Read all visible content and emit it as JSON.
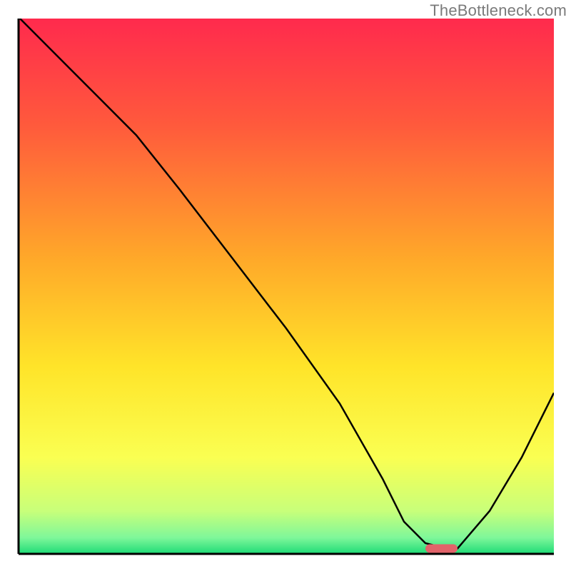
{
  "watermark": "TheBottleneck.com",
  "chart_data": {
    "type": "line",
    "title": "",
    "xlabel": "",
    "ylabel": "",
    "xlim": [
      0,
      100
    ],
    "ylim": [
      0,
      100
    ],
    "grid": false,
    "legend": false,
    "background_gradient": {
      "stops": [
        {
          "offset": 0.0,
          "color": "#ff2a4d"
        },
        {
          "offset": 0.2,
          "color": "#ff5a3c"
        },
        {
          "offset": 0.45,
          "color": "#ffa929"
        },
        {
          "offset": 0.65,
          "color": "#ffe429"
        },
        {
          "offset": 0.82,
          "color": "#faff52"
        },
        {
          "offset": 0.92,
          "color": "#c8ff7a"
        },
        {
          "offset": 0.97,
          "color": "#7ef79a"
        },
        {
          "offset": 1.0,
          "color": "#1edb76"
        }
      ]
    },
    "series": [
      {
        "name": "bottleneck-curve",
        "x": [
          0,
          10,
          22,
          30,
          40,
          50,
          60,
          68,
          72,
          76,
          80,
          82,
          88,
          94,
          100
        ],
        "y": [
          100,
          90,
          78,
          68,
          55,
          42,
          28,
          14,
          6,
          2,
          1,
          1,
          8,
          18,
          30
        ]
      }
    ],
    "marker": {
      "name": "optimal-range",
      "x_start": 76,
      "x_end": 82,
      "y": 1,
      "color": "#e2636a"
    }
  }
}
